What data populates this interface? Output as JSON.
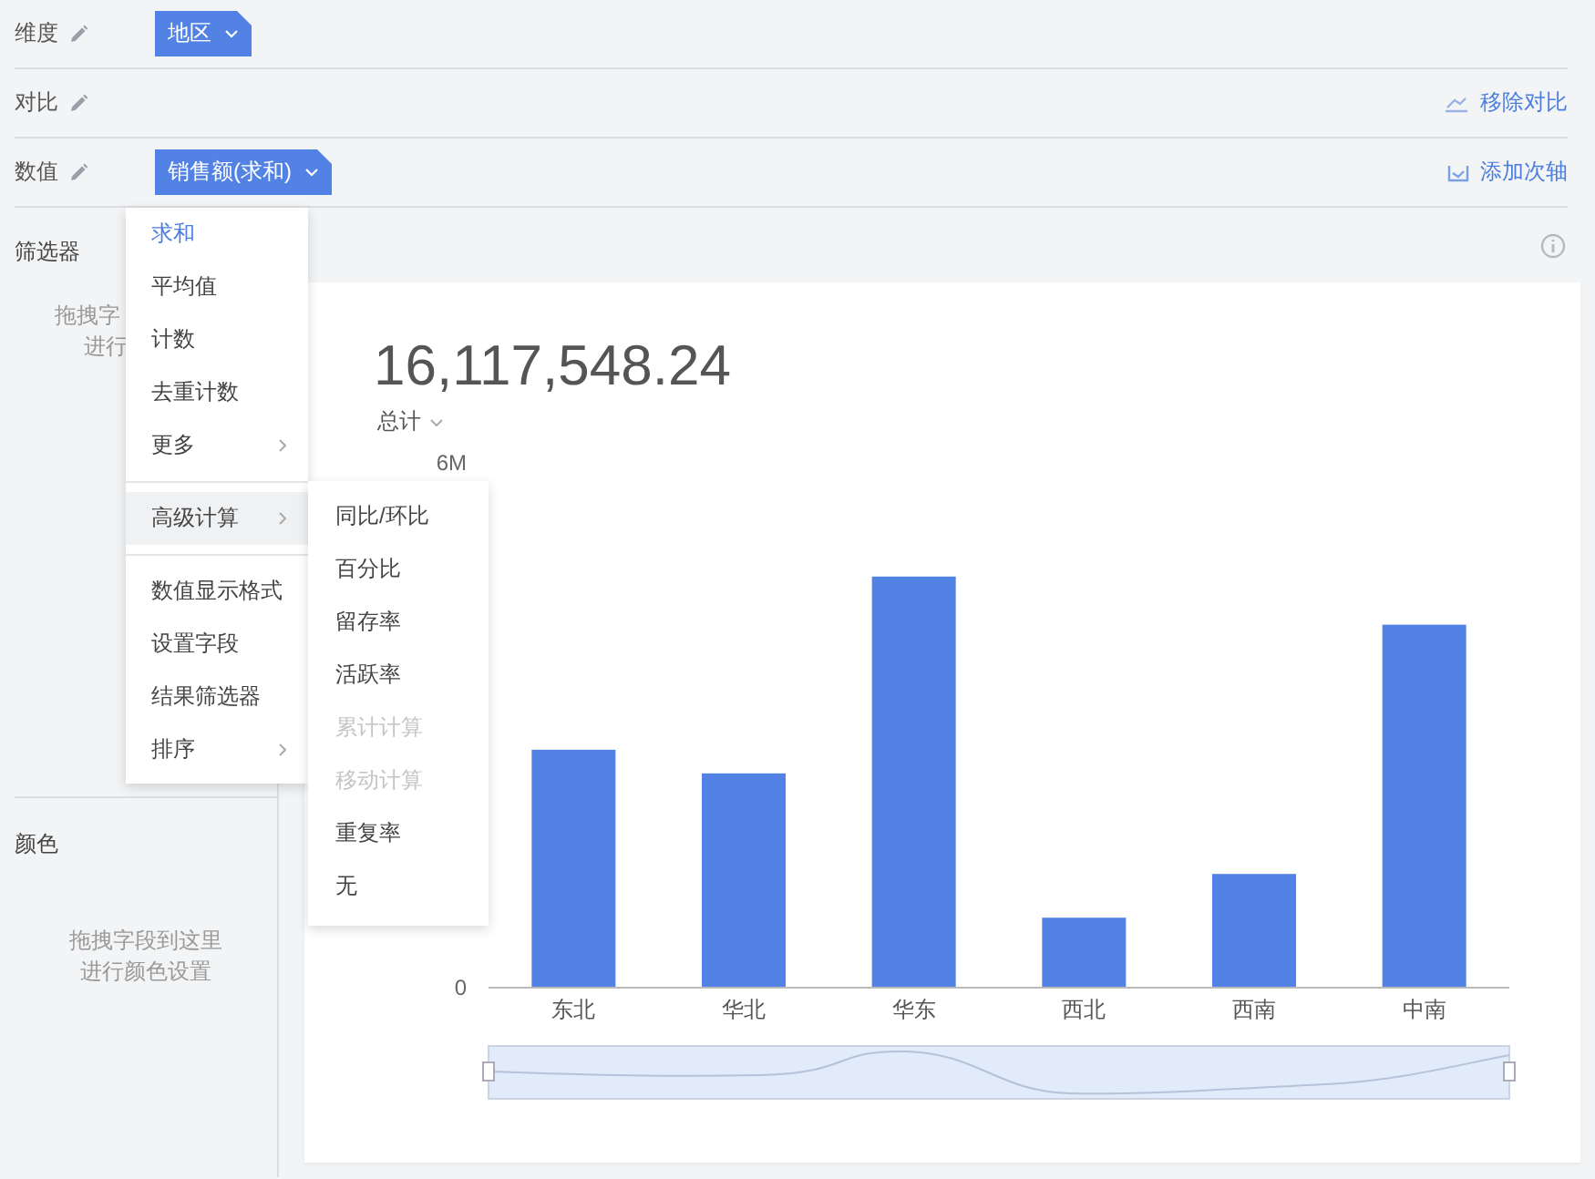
{
  "rows": [
    {
      "label": "维度",
      "chip": "地区",
      "action": null
    },
    {
      "label": "对比",
      "chip": null,
      "action": "移除对比",
      "kind": "remove"
    },
    {
      "label": "数值",
      "chip": "销售额(求和)",
      "action": "添加次轴",
      "kind": "axis"
    }
  ],
  "filter": {
    "title": "筛选器",
    "hint_lines": [
      "拖拽字",
      "进行"
    ]
  },
  "color_section": {
    "title": "颜色",
    "hint_lines": [
      "拖拽字段到这里",
      "进行颜色设置"
    ]
  },
  "menu": {
    "sections": [
      {
        "items": [
          {
            "label": "求和",
            "selected": true,
            "has_submenu": false
          },
          {
            "label": "平均值",
            "selected": false,
            "has_submenu": false
          },
          {
            "label": "计数",
            "selected": false,
            "has_submenu": false
          },
          {
            "label": "去重计数",
            "selected": false,
            "has_submenu": false
          },
          {
            "label": "更多",
            "selected": false,
            "has_submenu": true
          }
        ]
      },
      {
        "items": [
          {
            "label": "高级计算",
            "selected": false,
            "has_submenu": true,
            "expanded": true
          }
        ]
      },
      {
        "items": [
          {
            "label": "数值显示格式",
            "selected": false,
            "has_submenu": false
          },
          {
            "label": "设置字段",
            "selected": false,
            "has_submenu": false
          },
          {
            "label": "结果筛选器",
            "selected": false,
            "has_submenu": false
          },
          {
            "label": "排序",
            "selected": false,
            "has_submenu": true
          }
        ]
      }
    ]
  },
  "submenu": {
    "items": [
      {
        "label": "同比/环比",
        "disabled": false
      },
      {
        "label": "百分比",
        "disabled": false
      },
      {
        "label": "留存率",
        "disabled": false
      },
      {
        "label": "活跃率",
        "disabled": false
      },
      {
        "label": "累计计算",
        "disabled": true
      },
      {
        "label": "移动计算",
        "disabled": true
      },
      {
        "label": "重复率",
        "disabled": false
      },
      {
        "label": "无",
        "disabled": false
      }
    ]
  },
  "card": {
    "total": "16,117,548.24",
    "total_label": "总计",
    "chart_data": {
      "type": "bar",
      "categories": [
        "东北",
        "华北",
        "华东",
        "西北",
        "西南",
        "中南"
      ],
      "values": [
        2720000,
        2450000,
        4700000,
        800000,
        1300000,
        4150000
      ],
      "ylim": [
        0,
        6000000
      ],
      "yticks": [
        {
          "value": 0,
          "label": "0"
        },
        {
          "value": 6000000,
          "label": "6M"
        }
      ]
    }
  }
}
